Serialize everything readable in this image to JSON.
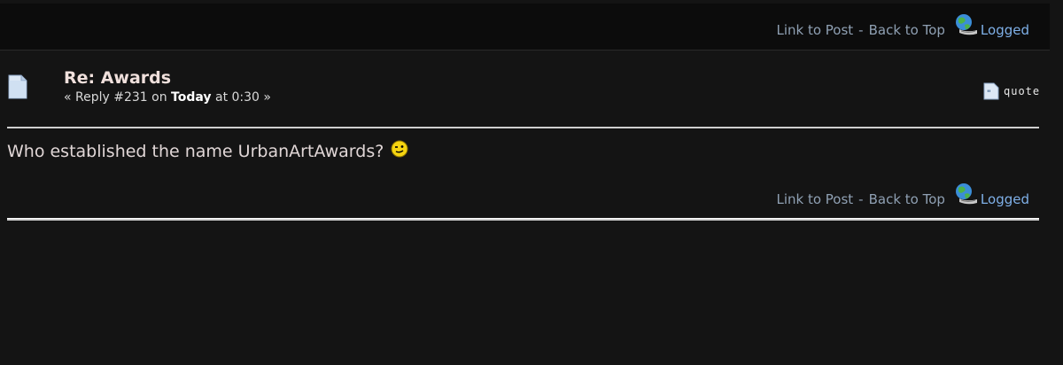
{
  "top_footer": {
    "link_to_post": "Link to Post",
    "separator": "-",
    "back_to_top": "Back to Top",
    "logged": "Logged"
  },
  "post": {
    "title": "Re: Awards",
    "meta_prefix": "« Reply #231 on",
    "meta_day": "Today",
    "meta_suffix": "at 0:30 »",
    "quote_label": "quote",
    "body_text": "Who established the name UrbanArtAwards?",
    "smiley": "wink-smiley-icon"
  },
  "post_footer": {
    "link_to_post": "Link to Post",
    "separator": "-",
    "back_to_top": "Back to Top",
    "logged": "Logged"
  },
  "colors": {
    "background": "#141414",
    "link": "#8fa0b3",
    "logged": "#7fb0e8",
    "title": "#f0e0dc"
  }
}
